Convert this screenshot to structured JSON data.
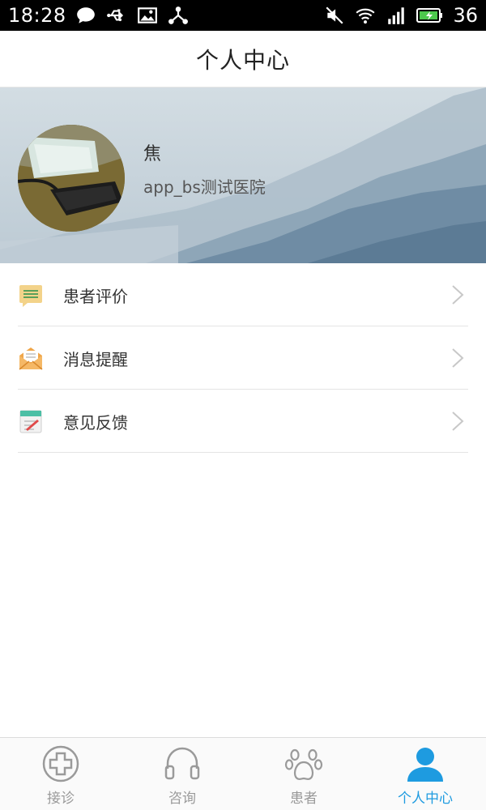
{
  "status_bar": {
    "time": "18:28",
    "battery_percent": "36",
    "icons_left": [
      "chat-bubble-icon",
      "usb-icon",
      "image-icon",
      "share-icon"
    ],
    "icons_right": [
      "mute-icon",
      "wifi-icon",
      "signal-3g-icon",
      "battery-icon"
    ]
  },
  "header": {
    "title": "个人中心"
  },
  "profile": {
    "name": "焦",
    "hospital": "app_bs测试医院"
  },
  "menu": {
    "items": [
      {
        "label": "患者评价",
        "icon": "review-icon"
      },
      {
        "label": "消息提醒",
        "icon": "mail-icon"
      },
      {
        "label": "意见反馈",
        "icon": "feedback-icon"
      }
    ]
  },
  "bottom_nav": {
    "tabs": [
      {
        "label": "接诊",
        "icon": "medical-cross-icon",
        "active": false
      },
      {
        "label": "咨询",
        "icon": "headset-icon",
        "active": false
      },
      {
        "label": "患者",
        "icon": "paw-icon",
        "active": false
      },
      {
        "label": "个人中心",
        "icon": "person-icon",
        "active": true
      }
    ]
  },
  "colors": {
    "accent": "#1e9be0",
    "inactive": "#9a9a9a",
    "status_bar": "#000000"
  }
}
